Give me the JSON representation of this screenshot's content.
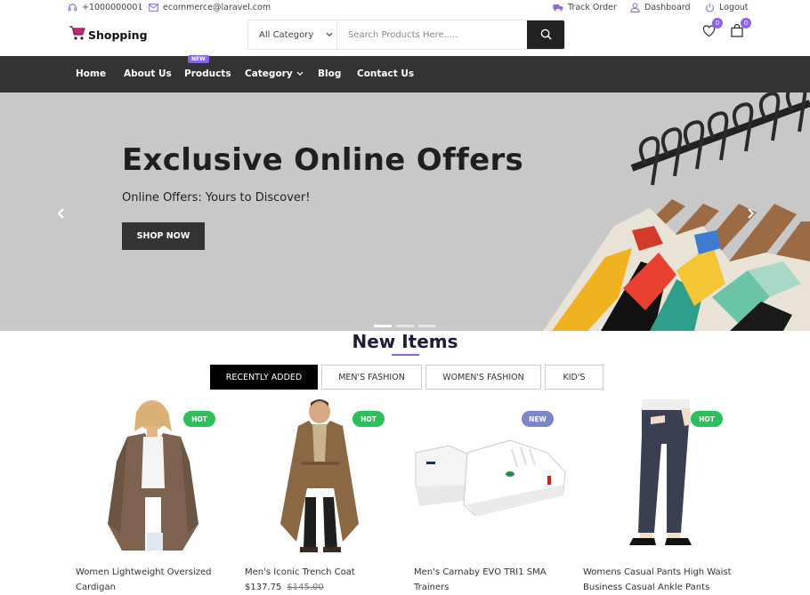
{
  "topbar": {
    "phone": "+1000000001",
    "email": "ecommerce@laravel.com",
    "track_order": "Track Order",
    "dashboard": "Dashboard",
    "logout": "Logout"
  },
  "header": {
    "logo_text": "Shopping",
    "category_select": "All Category",
    "search_placeholder": "Search Products Here.....",
    "wishlist_count": "0",
    "cart_count": "0"
  },
  "nav": {
    "items": [
      "Home",
      "About Us",
      "Products",
      "Category",
      "Blog",
      "Contact Us"
    ],
    "new_badge": "NEW"
  },
  "hero": {
    "title": "Exclusive Online Offers",
    "subtitle": "Online Offers: Yours to Discover!",
    "button": "SHOP NOW",
    "active_slide": 1,
    "slide_count": 3
  },
  "section": {
    "title": "New Items",
    "tabs": [
      "RECENTLY ADDED",
      "MEN'S FASHION",
      "WOMEN'S FASHION",
      "KID'S"
    ]
  },
  "products": [
    {
      "name": "Women Lightweight Oversized Cardigan",
      "tag": "HOT"
    },
    {
      "name": "Men's Iconic Trench Coat",
      "tag": "HOT",
      "price": "$137.75",
      "old_price": "$145.00"
    },
    {
      "name": "Men's Carnaby EVO TRI1 SMA Trainers",
      "tag": "NEW"
    },
    {
      "name": "Womens Casual Pants High Waist Business Casual Ankle Pants",
      "tag": "HOT"
    }
  ],
  "colors": {
    "accent": "#8a63e8",
    "nav_bg": "#333333",
    "hot_tag": "#2bc05a",
    "new_tag": "#7b86c8",
    "hero_bg": "#c8c8c8"
  },
  "icons": {
    "phone": "headset-icon",
    "email": "envelope-icon",
    "track_order": "truck-icon",
    "dashboard": "user-icon",
    "logout": "power-icon",
    "logo": "shopping-cart-icon",
    "search": "search-icon",
    "wishlist": "heart-icon",
    "cart": "shopping-bag-icon"
  }
}
